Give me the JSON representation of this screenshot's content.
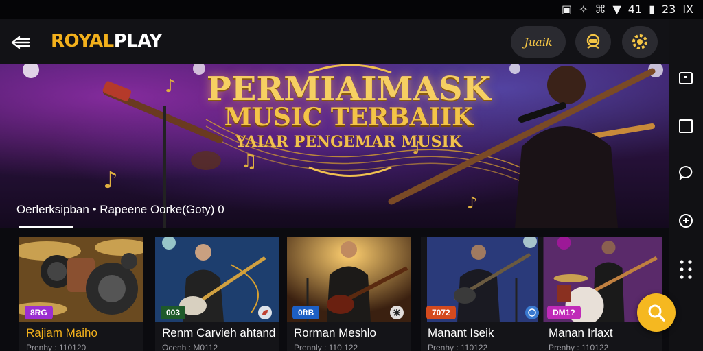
{
  "statusbar": {
    "icons": [
      "calendar-icon",
      "vibrate-icon",
      "data-icon",
      "wifi-icon",
      "signal-icon",
      "battery-icon"
    ],
    "signal_text": "41",
    "time": "23",
    "close": "IX"
  },
  "topbar": {
    "logo_part1": "ROYAL",
    "logo_part2": "PLAY",
    "pill_label": "Juaik",
    "accent": "#f2b01c"
  },
  "hero": {
    "title_line1": "PERMIAIMASK",
    "title_line2": "MUSIC TERBAIIK",
    "title_line3": "YAIAR PENGEMAR MUSIK",
    "caption": "Oerlerksipban • Rapeene Oorke(Goty) 0"
  },
  "cards": [
    {
      "tag": "8RG",
      "tag_color": "#9b2fd1",
      "title": "Rajiam Maiho",
      "sub": "Prenhy : 110120",
      "title_color": "gold"
    },
    {
      "tag": "003",
      "tag_color": "#1e5a2a",
      "title": "Renm Carvieh ahtand",
      "sub": "Ocenh : M0112",
      "title_color": "white"
    },
    {
      "tag": "0ftB",
      "tag_color": "#1d5fc4",
      "title": "Rorman Meshlo",
      "sub": "Prennly : 110 122",
      "title_color": "white"
    },
    {
      "tag": "7072",
      "tag_color": "#d44a1e",
      "title": "Manant Iseik",
      "sub": "Prenhy : 110122",
      "title_color": "white"
    },
    {
      "tag": "DM1?",
      "tag_color": "#c02ab8",
      "title": "Manan Irlaxt",
      "sub": "Prenhy : 110122",
      "title_color": "white"
    }
  ],
  "fab": {
    "icon": "search-icon"
  }
}
